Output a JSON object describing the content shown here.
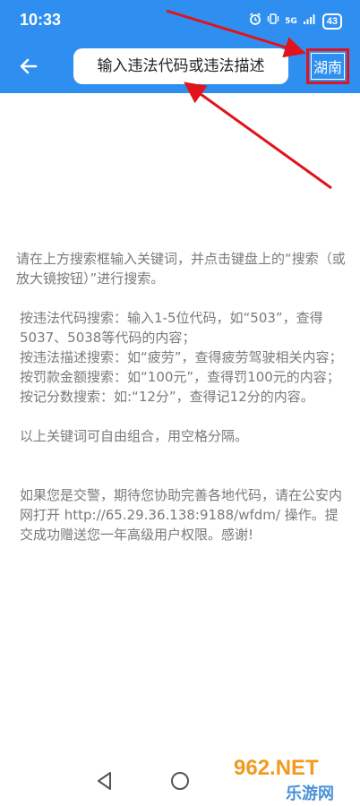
{
  "status_bar": {
    "time": "10:33",
    "network": "5G",
    "battery": "43"
  },
  "toolbar": {
    "search_placeholder": "输入违法代码或违法描述",
    "region_label": "湖南"
  },
  "help": {
    "intro": "请在上方搜索框输入关键词，并点击键盘上的“搜索（或放大镜按钮）”进行搜索。",
    "by_code": "按违法代码搜索：输入1-5位代码，如“503”，查得5037、5038等代码的内容；",
    "by_desc": "按违法描述搜索：如“疲劳”，查得疲劳驾驶相关内容；",
    "by_fine": "按罚款金额搜索：如“100元”，查得罚100元的内容；",
    "by_points": "按记分数搜索：如:“12分”，查得记12分的内容。",
    "combine": "以上关键词可自由组合，用空格分隔。",
    "police": "如果您是交警，期待您协助完善各地代码，请在公安内网打开 http://65.29.36.138:9188/wfdm/ 操作。提交成功赠送您一年高级用户权限。感谢!"
  },
  "watermark": {
    "brand": "962.NET",
    "site": "乐游网"
  },
  "colors": {
    "primary": "#2f8ff0",
    "annotation_red": "#e0141a",
    "help_text": "#7a7a7a"
  }
}
